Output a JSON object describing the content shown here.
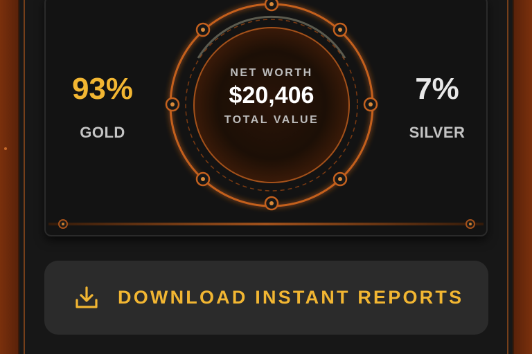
{
  "stats": {
    "gold": {
      "value": "93%",
      "label": "GOLD"
    },
    "silver": {
      "value": "7%",
      "label": "SILVER"
    }
  },
  "center": {
    "top_label": "NET WORTH",
    "value": "$20,406",
    "bottom_label": "TOTAL VALUE"
  },
  "download": {
    "label": "DOWNLOAD INSTANT REPORTS",
    "icon": "download-icon"
  },
  "colors": {
    "gold": "#f2b632",
    "accent_orange": "#c4611e",
    "background": "#131313"
  }
}
